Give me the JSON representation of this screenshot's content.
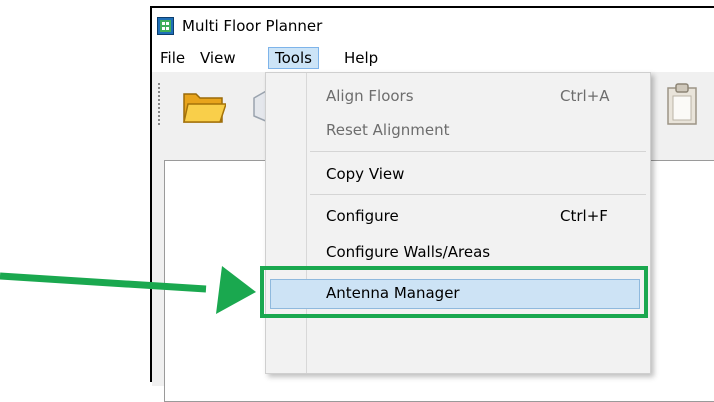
{
  "window": {
    "title": "Multi Floor Planner"
  },
  "menubar": {
    "items": [
      {
        "label": "File"
      },
      {
        "label": "View"
      },
      {
        "label": "Tools",
        "active": true
      },
      {
        "label": "Help"
      }
    ]
  },
  "toolbar": {
    "icons": [
      "open-folder-icon",
      "shape-icon",
      "clipboard-icon"
    ]
  },
  "tools_menu": {
    "items": [
      {
        "label": "Align Floors",
        "shortcut": "Ctrl+A",
        "enabled": false
      },
      {
        "label": "Reset Alignment",
        "shortcut": "",
        "enabled": false
      },
      {
        "label": "Copy View",
        "shortcut": "",
        "enabled": true
      },
      {
        "label": "Configure",
        "shortcut": "Ctrl+F",
        "enabled": true
      },
      {
        "label": "Configure Walls/Areas",
        "shortcut": "",
        "enabled": true
      },
      {
        "label": "Antenna Manager",
        "shortcut": "",
        "enabled": true,
        "highlighted": true
      }
    ]
  },
  "annotation": {
    "color": "#1aa84f"
  },
  "colors": {
    "menu_highlight": "#cde3f5",
    "menu_highlight_border": "#8fb9dd",
    "active_menu": "#cce4f7"
  }
}
